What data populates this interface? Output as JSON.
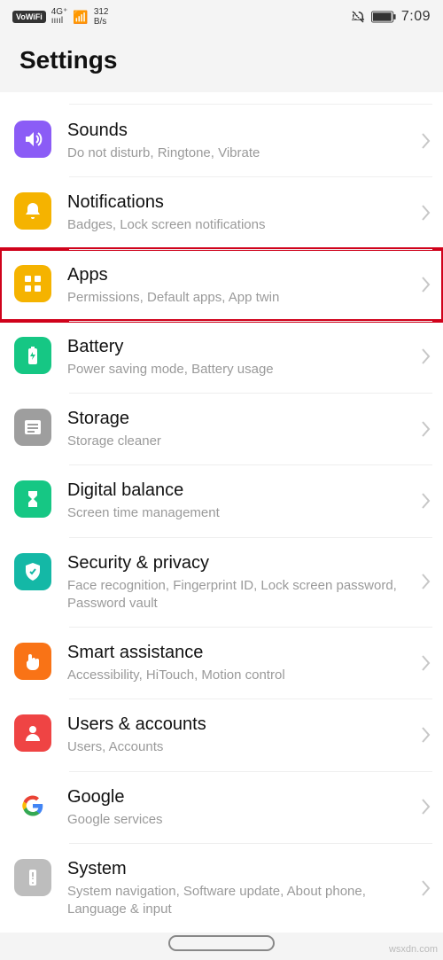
{
  "status": {
    "vowifi": "VoWiFi",
    "net": "4G⁺",
    "rate_top": "312",
    "rate_bot": "B/s",
    "battery": "93",
    "time": "7:09"
  },
  "title": "Settings",
  "rows": [
    {
      "id": "sounds",
      "label": "Sounds",
      "sub": "Do not disturb, Ringtone, Vibrate"
    },
    {
      "id": "notifications",
      "label": "Notifications",
      "sub": "Badges, Lock screen notifications"
    },
    {
      "id": "apps",
      "label": "Apps",
      "sub": "Permissions, Default apps, App twin"
    },
    {
      "id": "battery",
      "label": "Battery",
      "sub": "Power saving mode, Battery usage"
    },
    {
      "id": "storage",
      "label": "Storage",
      "sub": "Storage cleaner"
    },
    {
      "id": "digital",
      "label": "Digital balance",
      "sub": "Screen time management"
    },
    {
      "id": "security",
      "label": "Security & privacy",
      "sub": "Face recognition, Fingerprint ID, Lock screen password, Password vault"
    },
    {
      "id": "smart",
      "label": "Smart assistance",
      "sub": "Accessibility, HiTouch, Motion control"
    },
    {
      "id": "users",
      "label": "Users & accounts",
      "sub": "Users, Accounts"
    },
    {
      "id": "google",
      "label": "Google",
      "sub": "Google services"
    },
    {
      "id": "system",
      "label": "System",
      "sub": "System navigation, Software update, About phone, Language & input"
    }
  ],
  "watermark": "wsxdn.com"
}
